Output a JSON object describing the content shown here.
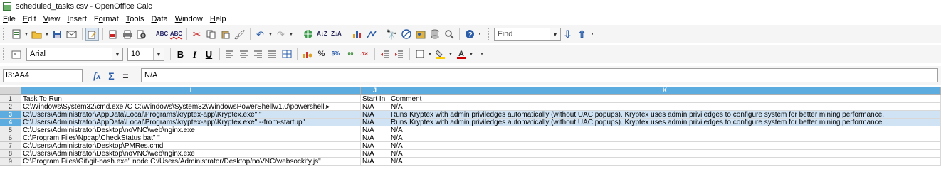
{
  "window": {
    "title": "scheduled_tasks.csv - OpenOffice Calc"
  },
  "menu": [
    {
      "pre": "",
      "u": "F",
      "post": "ile"
    },
    {
      "pre": "",
      "u": "E",
      "post": "dit"
    },
    {
      "pre": "",
      "u": "V",
      "post": "iew"
    },
    {
      "pre": "",
      "u": "I",
      "post": "nsert"
    },
    {
      "pre": "F",
      "u": "o",
      "post": "rmat"
    },
    {
      "pre": "",
      "u": "T",
      "post": "ools"
    },
    {
      "pre": "",
      "u": "D",
      "post": "ata"
    },
    {
      "pre": "",
      "u": "W",
      "post": "indow"
    },
    {
      "pre": "",
      "u": "H",
      "post": "elp"
    }
  ],
  "toolbar": {
    "find_placeholder": "Find"
  },
  "formatting": {
    "font_name": "Arial",
    "font_size": "10",
    "bold": "B",
    "italic": "I",
    "underline": "U"
  },
  "formula_bar": {
    "name_box": "I3:AA4",
    "function_wizard": "fx",
    "sum": "Σ",
    "equals": "=",
    "content": "N/A"
  },
  "sheet": {
    "columns": [
      {
        "label": "I",
        "selected": true
      },
      {
        "label": "J",
        "selected": true
      },
      {
        "label": "K",
        "selected": true
      }
    ],
    "rows": [
      {
        "num": "1",
        "selected": false,
        "i": "Task To Run",
        "j": "Start In",
        "k": "Comment"
      },
      {
        "num": "2",
        "selected": false,
        "i": "C:\\Windows\\System32\\cmd.exe /C C:\\Windows\\System32\\WindowsPowerShell\\v1.0\\powershell.▸",
        "j": "N/A",
        "k": "N/A"
      },
      {
        "num": "3",
        "selected": true,
        "i": "C:\\Users\\Administrator\\AppData\\Local\\Programs\\kryptex-app\\Kryptex.exe\" \"",
        "j": "N/A",
        "k": "Runs Kryptex with admin priviledges automatically (without UAC popups). Kryptex uses admin priviledges to configure system for better mining performance."
      },
      {
        "num": "4",
        "selected": true,
        "i": "C:\\Users\\Administrator\\AppData\\Local\\Programs\\kryptex-app\\Kryptex.exe\" --from-startup\"",
        "j": "N/A",
        "k": "Runs Kryptex with admin priviledges automatically (without UAC popups). Kryptex uses admin priviledges to configure system for better mining performance."
      },
      {
        "num": "5",
        "selected": false,
        "i": "C:\\Users\\Administrator\\Desktop\\noVNC\\web\\nginx.exe",
        "j": "N/A",
        "k": "N/A"
      },
      {
        "num": "6",
        "selected": false,
        "i": "C:\\Program Files\\Npcap\\CheckStatus.bat\" \"",
        "j": "N/A",
        "k": "N/A"
      },
      {
        "num": "7",
        "selected": false,
        "i": "C:\\Users\\Administrator\\Desktop\\PMRes.cmd",
        "j": "N/A",
        "k": "N/A"
      },
      {
        "num": "8",
        "selected": false,
        "i": "C:\\Users\\Administrator\\Desktop\\noVNC\\web\\nginx.exe",
        "j": "N/A",
        "k": "N/A"
      },
      {
        "num": "9",
        "selected": false,
        "i": "C:\\Program Files\\Git\\git-bash.exe\" node C:/Users/Administrator/Desktop/noVNC/websockify.js\"",
        "j": "N/A",
        "k": "N/A"
      }
    ]
  },
  "colors": {
    "selection_header": "#5dacdf",
    "selection_fill": "#cfe3f4",
    "toolbar_bg": "#f5f5f5"
  }
}
